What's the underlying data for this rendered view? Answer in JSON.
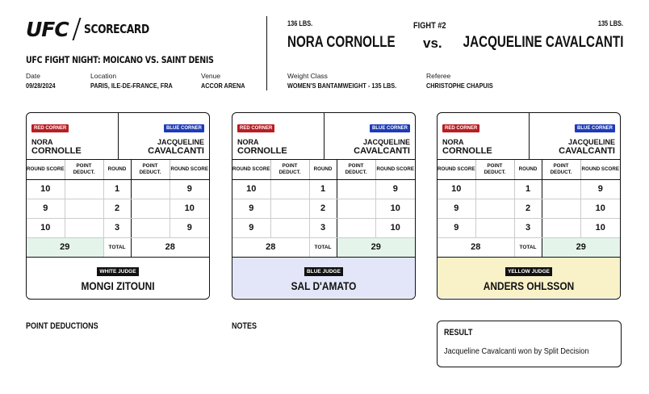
{
  "brand": {
    "logo_text": "UFC",
    "section": "SCORECARD"
  },
  "event": {
    "title": "UFC FIGHT NIGHT: MOICANO VS. SAINT DENIS",
    "date_label": "Date",
    "date": "09/28/2024",
    "location_label": "Location",
    "location": "PARIS, ILE-DE-FRANCE, FRA",
    "venue_label": "Venue",
    "venue": "ACCOR ARENA"
  },
  "fight": {
    "number": "FIGHT #2",
    "red_weight": "136 LBS.",
    "blue_weight": "135 LBS.",
    "red_fighter": "NORA CORNOLLE",
    "vs": "vs.",
    "blue_fighter": "JACQUELINE CAVALCANTI",
    "weight_class_label": "Weight Class",
    "weight_class": "WOMEN'S BANTAMWEIGHT - 135 LBS.",
    "referee_label": "Referee",
    "referee": "CHRISTOPHE CHAPUIS"
  },
  "corners": {
    "red_label": "RED CORNER",
    "blue_label": "BLUE CORNER",
    "red_first": "NORA",
    "red_last": "CORNOLLE",
    "blue_first": "JACQUELINE",
    "blue_last": "CAVALCANTI"
  },
  "columns": {
    "round_score": "ROUND SCORE",
    "point_deduct": "POINT DEDUCT.",
    "round": "ROUND",
    "total": "TOTAL"
  },
  "cards": [
    {
      "judge_label": "WHITE JUDGE",
      "judge_name": "MONGI ZITOUNI",
      "bg": "#ffffff",
      "rounds": [
        {
          "round": "1",
          "red": "10",
          "blue": "9"
        },
        {
          "round": "2",
          "red": "9",
          "blue": "10"
        },
        {
          "round": "3",
          "red": "10",
          "blue": "9"
        }
      ],
      "red_total": "29",
      "blue_total": "28",
      "winner": "red"
    },
    {
      "judge_label": "BLUE JUDGE",
      "judge_name": "SAL D'AMATO",
      "bg": "#e2e6f8",
      "rounds": [
        {
          "round": "1",
          "red": "10",
          "blue": "9"
        },
        {
          "round": "2",
          "red": "9",
          "blue": "10"
        },
        {
          "round": "3",
          "red": "9",
          "blue": "10"
        }
      ],
      "red_total": "28",
      "blue_total": "29",
      "winner": "blue"
    },
    {
      "judge_label": "YELLOW JUDGE",
      "judge_name": "ANDERS OHLSSON",
      "bg": "#f9f1c8",
      "rounds": [
        {
          "round": "1",
          "red": "10",
          "blue": "9"
        },
        {
          "round": "2",
          "red": "9",
          "blue": "10"
        },
        {
          "round": "3",
          "red": "9",
          "blue": "10"
        }
      ],
      "red_total": "28",
      "blue_total": "29",
      "winner": "blue"
    }
  ],
  "footer": {
    "point_deductions_label": "POINT DEDUCTIONS",
    "notes_label": "NOTES",
    "result_label": "RESULT",
    "result_text": "Jacqueline Cavalcanti won by Split Decision"
  },
  "colors": {
    "red_corner": "#b91d22",
    "blue_corner": "#1d3ab8",
    "winner_cell": "#e4f4ea"
  }
}
